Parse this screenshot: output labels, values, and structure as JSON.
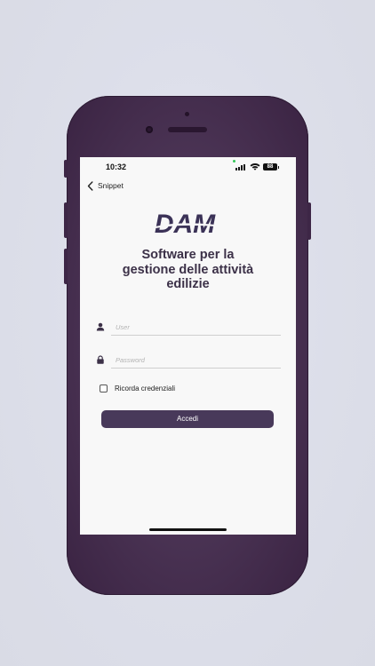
{
  "status_bar": {
    "time": "10:32",
    "battery": "88"
  },
  "nav": {
    "back_label": "Snippet"
  },
  "brand": {
    "logo_text": "DAM",
    "logo_color": "#3b3257"
  },
  "page": {
    "title_lines": [
      "Software per la",
      "gestione delle attività",
      "edilizie"
    ]
  },
  "form": {
    "user_placeholder": "User",
    "password_placeholder": "Password",
    "remember_label": "Ricorda credenziali",
    "remember_checked": false,
    "submit_label": "Accedi"
  },
  "icons": {
    "back": "chevron-left-icon",
    "user": "user-icon",
    "password": "lock-icon",
    "signal": "signal-icon",
    "wifi": "wifi-icon",
    "battery": "battery-icon"
  },
  "colors": {
    "accent": "#48395a",
    "title": "#3c3148",
    "phone_frame": "#4d3657",
    "background": "#dcdee9"
  }
}
